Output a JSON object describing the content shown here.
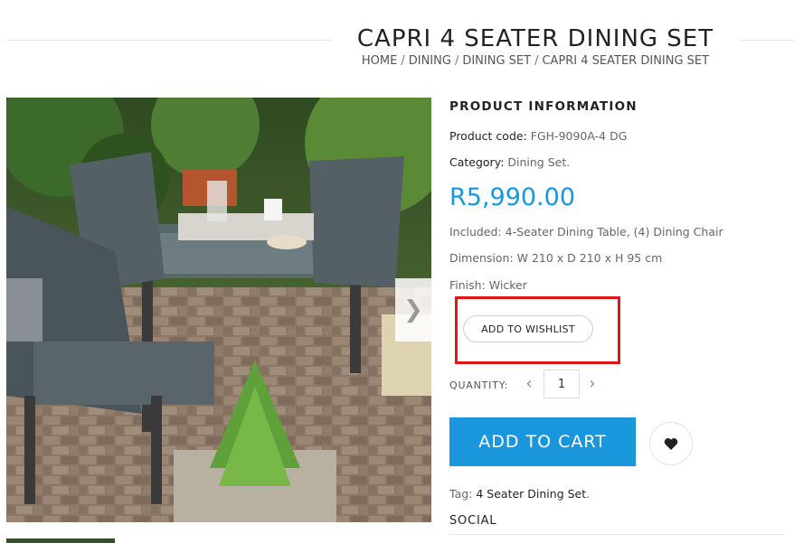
{
  "page": {
    "title": "CAPRI 4 SEATER DINING SET",
    "breadcrumb": [
      "HOME",
      "DINING",
      "DINING SET",
      "CAPRI 4 SEATER DINING SET"
    ],
    "breadcrumb_separator": "/"
  },
  "gallery": {
    "prev_icon": "chevron-left-icon",
    "next_icon": "chevron-right-icon",
    "next_glyph": "❯"
  },
  "product": {
    "section_heading": "PRODUCT INFORMATION",
    "code_label": "Product code:",
    "code_value": "FGH-9090A-4 DG",
    "category_label": "Category:",
    "category_value": "Dining Set",
    "category_suffix": ".",
    "price": "R5,990.00",
    "included": "Included: 4-Seater Dining Table, (4) Dining Chair",
    "dimension": "Dimension: W 210 x D 210 x H 95 cm",
    "finish": "Finish: Wicker",
    "wishlist_label": "ADD TO WISHLIST",
    "quantity_label": "QUANTITY:",
    "quantity_value": "1",
    "qty_dec_glyph": "‹",
    "qty_inc_glyph": "›",
    "add_to_cart_label": "ADD TO CART",
    "tag_label": "Tag:",
    "tag_value": "4 Seater Dining Set",
    "tag_suffix": ".",
    "social_heading": "SOCIAL"
  },
  "colors": {
    "accent": "#1a96dd",
    "highlight": "#e0161b"
  }
}
